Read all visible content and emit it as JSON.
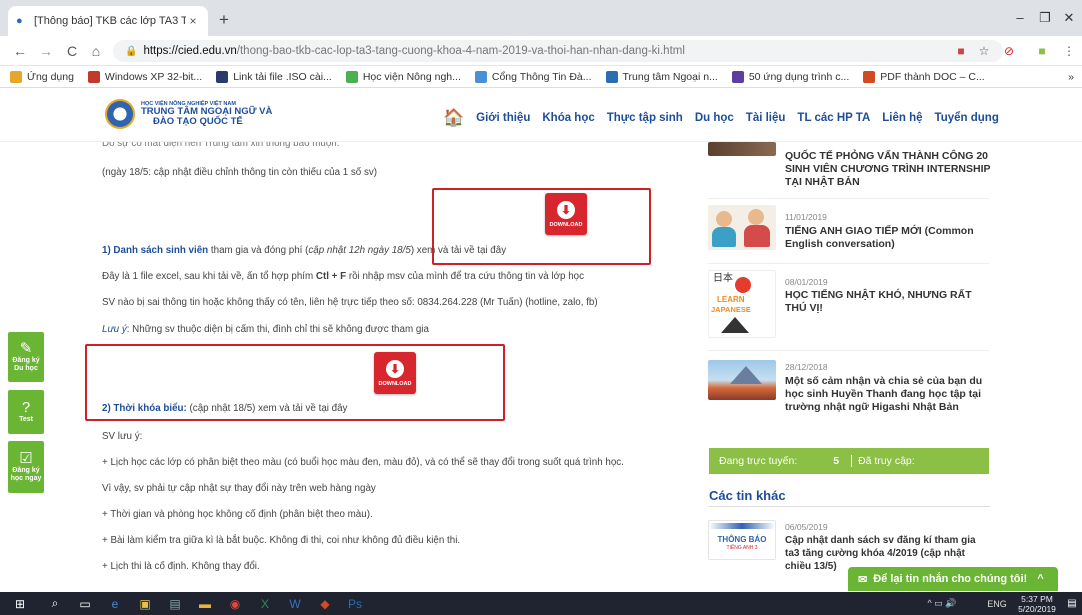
{
  "tab": {
    "title": "[Thông báo] TKB các lớp TA3 Tăn",
    "close": "×",
    "new": "+"
  },
  "window": {
    "minimize": "–",
    "restore": "❐",
    "close": "✕"
  },
  "nav": {
    "back": "←",
    "forward": "→",
    "reload": "C",
    "home": "⌂",
    "host": "https://cied.edu.vn",
    "path": "/thong-bao-tkb-cac-lop-ta3-tang-cuong-khoa-4-nam-2019-va-thoi-han-nhan-dang-ki.html"
  },
  "bookmarks": [
    {
      "label": "Ứng dụng",
      "color": "#e6a72a",
      "icon": "apps-icon"
    },
    {
      "label": "Windows XP 32-bit...",
      "color": "#c0392b",
      "icon": "site-icon"
    },
    {
      "label": "Link tải file .ISO cài...",
      "color": "#2a3a6a",
      "icon": "site-icon"
    },
    {
      "label": "Học viện Nông ngh...",
      "color": "#4caf50",
      "icon": "site-icon"
    },
    {
      "label": "Cổng Thông Tin Đà...",
      "color": "#4a90d9",
      "icon": "site-icon"
    },
    {
      "label": "Trung tâm Ngoại n...",
      "color": "#2a6db3",
      "icon": "site-icon"
    },
    {
      "label": "50 ứng dụng trình c...",
      "color": "#5b3fa0",
      "icon": "site-icon"
    },
    {
      "label": "PDF thành DOC – C...",
      "color": "#d24a24",
      "icon": "site-icon"
    }
  ],
  "bookmarks_more": "»",
  "logo": {
    "line1": "HỌC VIỆN NÔNG NGHIỆP VIỆT NAM",
    "line2": "TRUNG TÂM NGOẠI NGỮ VÀ",
    "line3": "ĐÀO TẠO QUỐC TẾ"
  },
  "menu": [
    "Giới thiệu",
    "Khóa học",
    "Thực tập sinh",
    "Du học",
    "Tài liệu",
    "TL các HP TA",
    "Liên hệ",
    "Tuyển dụng"
  ],
  "content": {
    "cut_top": "Do sự cố mất điện nên Trung tâm xin thông báo muộn.",
    "update_note": "(ngày 18/5: cập nhật điều chỉnh thông tin còn thiếu của 1 số sv)",
    "dl_label": "DOWNLOAD",
    "s1_title": "1) Danh sách sinh viên",
    "s1_mid": " tham gia và đóng phí (",
    "s1_italic": "cập nhật 12h ngày 18/5",
    "s1_end": ") xem và tải về tại đây",
    "p_excel_a": "Đây là 1 file excel, sau khi tải về, ấn tổ hợp phím ",
    "p_excel_b": "Ctl + F",
    "p_excel_c": " rồi nhập msv của mình để tra cứu thông tin và lớp học",
    "p_contact": "SV nào bị sai thông tin hoặc không thấy có tên, liên hệ trực tiếp theo số: 0834.264.228 (Mr Tuấn) (hotline, zalo, fb)",
    "p_note_a": "Lưu ý",
    "p_note_b": ": Những sv thuộc diện bị cấm thi, đình chỉ thi sẽ không được tham gia",
    "s2_title": "2) Thời khóa biểu:",
    "s2_end": " (cập nhật 18/5) xem và tải về tại đây",
    "p_sv": "SV lưu ý:",
    "p1": "+ Lịch học các lớp có phân biệt theo màu (có buổi học màu đen, màu đỏ), và có thể sẽ thay đổi trong suốt quá trình học.",
    "p2": "Vì vậy, sv phải tự cập nhật sự thay đổi này trên web hàng ngày",
    "p3": "+ Thời gian và phòng học không cố định (phân biệt theo màu).",
    "p4": "+ Bài làm kiểm tra giữa kì là bắt buộc. Không đi thi, coi như không đủ điều kiện thi.",
    "p5": "+ Lịch thi là cố định. Không thay đổi."
  },
  "side_buttons": [
    {
      "label1": "Đăng ký",
      "label2": "Du học",
      "icon": "✎"
    },
    {
      "label1": "Test",
      "label2": "",
      "icon": "?"
    },
    {
      "label1": "Đăng ký",
      "label2": "học ngay",
      "icon": "☑"
    }
  ],
  "news": [
    {
      "date": "",
      "title": "QUỐC TẾ PHỎNG VẤN THÀNH CÔNG 20 SINH VIÊN CHƯƠNG TRÌNH INTERNSHIP TẠI NHẬT BẢN"
    },
    {
      "date": "11/01/2019",
      "title": "TIẾNG ANH GIAO TIẾP MỚI (Common English conversation)"
    },
    {
      "date": "08/01/2019",
      "title": "HỌC TIẾNG NHẬT KHÓ, NHƯNG RẤT THÚ VỊ!"
    },
    {
      "date": "28/12/2018",
      "title": "Một số cảm nhận và chia sẻ của bạn du học sinh Huyền Thanh đang học tập tại trường nhật ngữ Higashi Nhật Bản"
    }
  ],
  "thumb_text": {
    "learn": "LEARN",
    "japanese": "JAPANESE",
    "ja": "日本"
  },
  "online": {
    "label": "Đang trực tuyến:",
    "count": "5",
    "visits": "Đã truy cập:"
  },
  "other": {
    "heading": "Các tin khác",
    "date": "06/05/2019",
    "title": "Cập nhật danh sách sv đăng kí tham gia ta3 tăng cường khóa 4/2019 (cập nhật chiều 13/5)",
    "thumb1": "THÔNG BÁO",
    "thumb2": "TIẾNG ANH 3"
  },
  "chat": {
    "label": "Để lại tin nhắn cho chúng tôi!",
    "arrow": "^"
  },
  "taskbar": {
    "time": "5:37 PM",
    "date": "5/20/2019",
    "lang": "ENG"
  }
}
